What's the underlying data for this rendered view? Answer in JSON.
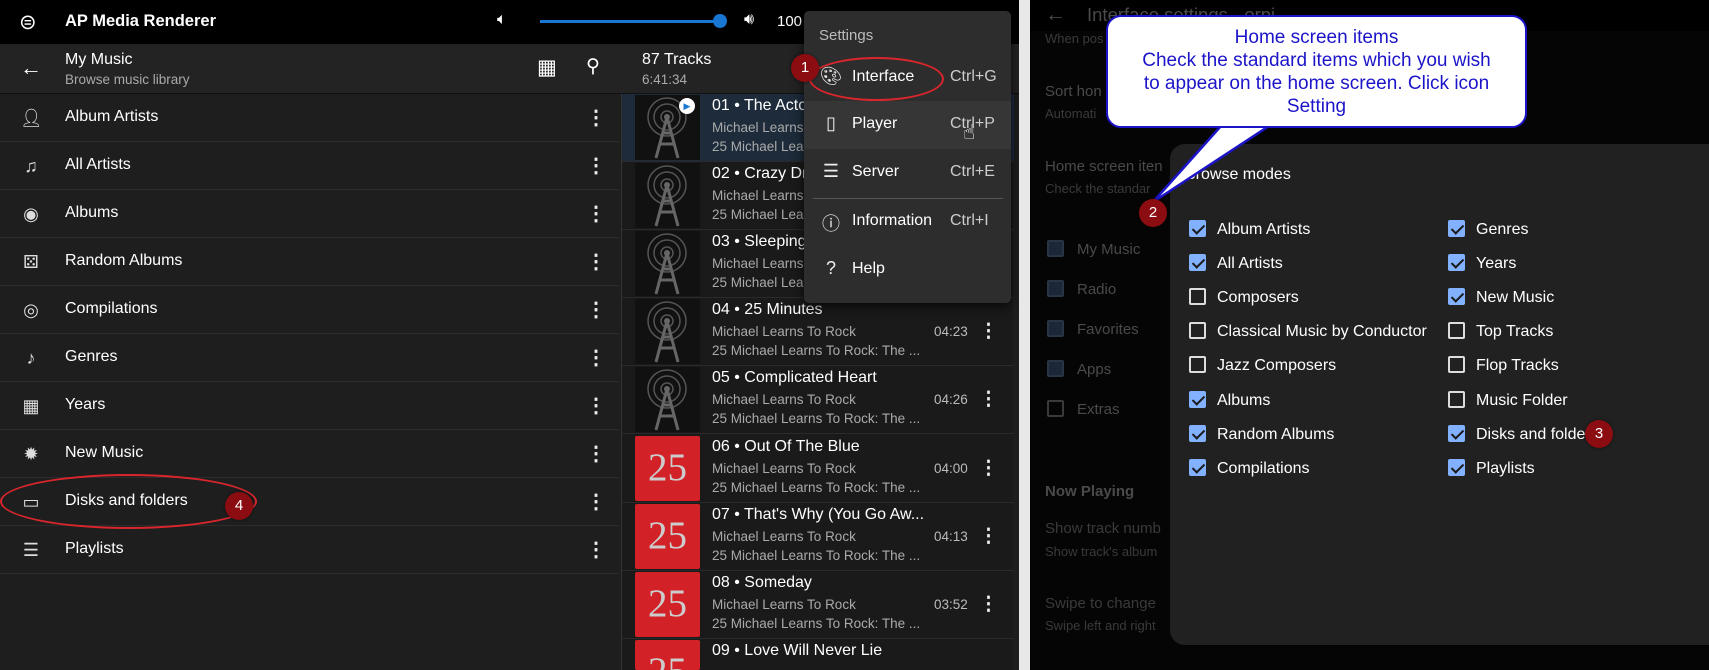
{
  "app": {
    "title": "AP Media Renderer",
    "volume_percent": 100,
    "volume_label": "100"
  },
  "header": {
    "title": "My Music",
    "subtitle": "Browse music library",
    "tracks_count": "87 Tracks",
    "tracks_duration": "6:41:34"
  },
  "library": [
    {
      "label": "Album Artists",
      "icon": "album-artist-icon"
    },
    {
      "label": "All Artists",
      "icon": "artist-icon"
    },
    {
      "label": "Albums",
      "icon": "album-icon"
    },
    {
      "label": "Random Albums",
      "icon": "dice-icon"
    },
    {
      "label": "Compilations",
      "icon": "compilation-icon"
    },
    {
      "label": "Genres",
      "icon": "guitar-icon"
    },
    {
      "label": "Years",
      "icon": "calendar-icon"
    },
    {
      "label": "New Music",
      "icon": "new-badge-icon"
    },
    {
      "label": "Disks and folders",
      "icon": "laptop-icon"
    },
    {
      "label": "Playlists",
      "icon": "list-icon"
    }
  ],
  "tracks": [
    {
      "title": "01 • The Acto",
      "artist": "Michael Learns",
      "album": "25 Michael Lea",
      "duration": "",
      "art": "radio"
    },
    {
      "title": "02 • Crazy Dr",
      "artist": "Michael Learns",
      "album": "25 Michael Lea",
      "duration": "",
      "art": "radio"
    },
    {
      "title": "03 • Sleeping",
      "artist": "Michael Learns",
      "album": "25 Michael Lea",
      "duration": "",
      "art": "radio"
    },
    {
      "title": "04 • 25 Minutes",
      "artist": "Michael Learns To Rock",
      "album": "25 Michael Learns To Rock: The ...",
      "duration": "04:23",
      "art": "radio"
    },
    {
      "title": "05 • Complicated Heart",
      "artist": "Michael Learns To Rock",
      "album": "25 Michael Learns To Rock: The ...",
      "duration": "04:26",
      "art": "radio"
    },
    {
      "title": "06 • Out Of The Blue",
      "artist": "Michael Learns To Rock",
      "album": "25 Michael Learns To Rock: The ...",
      "duration": "04:00",
      "art": "25"
    },
    {
      "title": "07 • That's Why (You Go Aw...",
      "artist": "Michael Learns To Rock",
      "album": "25 Michael Learns To Rock: The ...",
      "duration": "04:13",
      "art": "25"
    },
    {
      "title": "08 • Someday",
      "artist": "Michael Learns To Rock",
      "album": "25 Michael Learns To Rock: The ...",
      "duration": "03:52",
      "art": "25"
    },
    {
      "title": "09 • Love Will Never Lie",
      "artist": "",
      "album": "",
      "duration": "",
      "art": "25"
    }
  ],
  "settings_menu": {
    "title": "Settings",
    "items": [
      {
        "label": "Interface",
        "shortcut": "Ctrl+G"
      },
      {
        "label": "Player",
        "shortcut": "Ctrl+P"
      },
      {
        "label": "Server",
        "shortcut": "Ctrl+E"
      },
      {
        "label": "Information",
        "shortcut": "Ctrl+I"
      },
      {
        "label": "Help",
        "shortcut": ""
      }
    ]
  },
  "background_settings": {
    "title": "Interface settings - orpi",
    "partial1": "When pos",
    "sort_title": "Sort hon",
    "sort_sub": "Automati",
    "home_title": "Home screen iten",
    "home_sub": "Check the standar",
    "home_items": [
      {
        "label": "My Music",
        "checked": true
      },
      {
        "label": "Radio",
        "checked": true
      },
      {
        "label": "Favorites",
        "checked": true
      },
      {
        "label": "Apps",
        "checked": true
      },
      {
        "label": "Extras",
        "checked": false
      }
    ],
    "now_playing": "Now Playing",
    "track_title": "Show track numb",
    "track_sub": "Show track's album",
    "swipe_title": "Swipe to change",
    "swipe_sub": "Swipe left and right"
  },
  "browse_modes": {
    "title": "Browse modes",
    "col1": [
      {
        "label": "Album Artists",
        "checked": true
      },
      {
        "label": "All Artists",
        "checked": true
      },
      {
        "label": "Composers",
        "checked": false
      },
      {
        "label": "Classical Music by Conductor",
        "checked": false
      },
      {
        "label": "Jazz Composers",
        "checked": false
      },
      {
        "label": "Albums",
        "checked": true
      },
      {
        "label": "Random Albums",
        "checked": true
      },
      {
        "label": "Compilations",
        "checked": true
      }
    ],
    "col2": [
      {
        "label": "Genres",
        "checked": true
      },
      {
        "label": "Years",
        "checked": true
      },
      {
        "label": "New Music",
        "checked": true
      },
      {
        "label": "Top Tracks",
        "checked": false
      },
      {
        "label": "Flop Tracks",
        "checked": false
      },
      {
        "label": "Music Folder",
        "checked": false
      },
      {
        "label": "Disks and folde",
        "checked": true
      },
      {
        "label": "Playlists",
        "checked": true
      }
    ]
  },
  "callout": {
    "line1": "Home screen items",
    "line2": "Check the standard items which you wish",
    "line3": "to appear on the home screen. Click icon",
    "line4": "Setting"
  },
  "steps": [
    "1",
    "2",
    "3",
    "4"
  ],
  "colors": {
    "accent": "#82b1ff",
    "slider": "#1976d2",
    "annotation_red": "#8b0d12",
    "callout_blue": "#1c14c8",
    "album_art_red": "#d32128"
  }
}
